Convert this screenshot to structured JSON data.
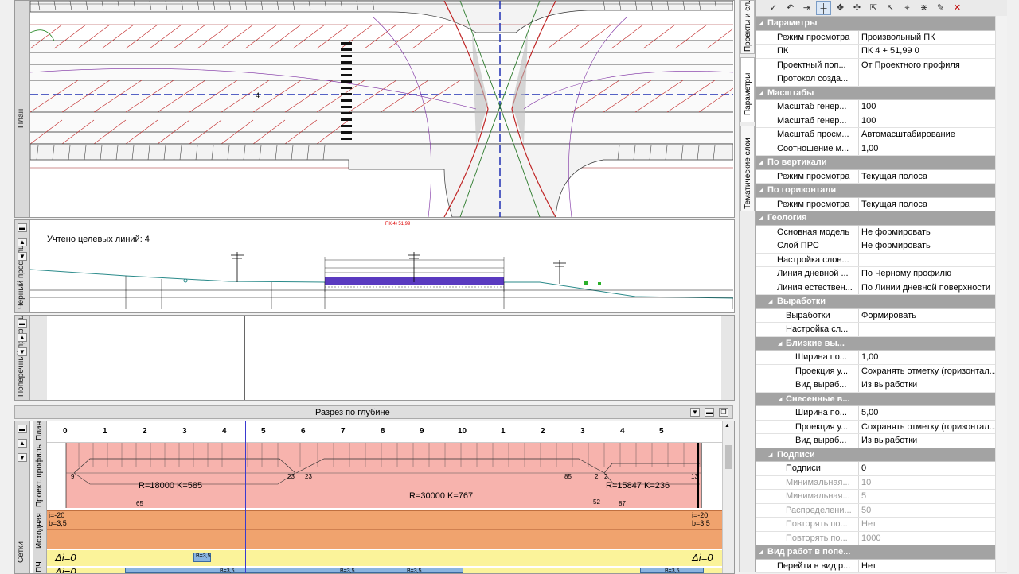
{
  "panes": {
    "plan": {
      "label": "План"
    },
    "profile": {
      "label": "Черный профиль",
      "target_lines": "Учтено целевых линий: 4",
      "pk_marker": "ПК 4+51,99",
      "axis_marker": "4"
    },
    "cross": {
      "label": "Поперечный профиль"
    },
    "depth": {
      "title": "Разрез по глубине"
    }
  },
  "grid": {
    "group_label": "Сетки",
    "row_labels": {
      "plan": "План",
      "design": "Проект. профиль",
      "source": "Исходная",
      "pch": "ПЧ"
    },
    "km_ticks": [
      "0",
      "1",
      "2",
      "3",
      "4",
      "5",
      "6",
      "7",
      "8",
      "9",
      "10",
      "1",
      "2",
      "3",
      "4",
      "5"
    ],
    "curves": [
      "R=18000  K=585",
      "R=30000  K=767",
      "R=15847  K=236"
    ],
    "curve_marks": [
      "9",
      "65",
      "23",
      "23",
      "85",
      "2",
      "2",
      "13",
      "52",
      "87"
    ],
    "slope_left_1": "i=-20",
    "slope_left_2": "b=3,5",
    "slope_right_1": "i=-20",
    "slope_right_2": "b=3,5",
    "delta_left": "Δi=0",
    "delta_right": "Δi=0",
    "pill_1": "B=3,5",
    "pill_2": "B=3,5",
    "pill_3": "B=3,5",
    "pill_4": "B=3,5",
    "pill_5": "B=3,5",
    "bottom_delta": "Δi=0"
  },
  "side_tabs": [
    "Проекты и сл...",
    "Параметры",
    "Тематические слои"
  ],
  "toolbar_icons": [
    "check-icon",
    "undo-icon",
    "next-icon",
    "crosshair-icon",
    "move-icon",
    "pan-icon",
    "select-icon",
    "pointer-icon",
    "snap-icon",
    "node-icon",
    "picker-icon",
    "close-icon"
  ],
  "properties": [
    {
      "t": "h",
      "k": "Параметры",
      "lv": 0
    },
    {
      "t": "r",
      "k": "Режим просмотра",
      "v": "Произвольный ПК",
      "lv": 0
    },
    {
      "t": "r",
      "k": "ПК",
      "v": "ПК    4 + 51,99  0",
      "lv": 0
    },
    {
      "t": "r",
      "k": "Проектный поп...",
      "v": "От Проектного профиля",
      "lv": 0
    },
    {
      "t": "r",
      "k": "Протокол созда...",
      "v": "",
      "lv": 0
    },
    {
      "t": "h",
      "k": "Масштабы",
      "lv": 0
    },
    {
      "t": "r",
      "k": "Масштаб генер...",
      "v": "100",
      "lv": 0
    },
    {
      "t": "r",
      "k": "Масштаб генер...",
      "v": "100",
      "lv": 0
    },
    {
      "t": "r",
      "k": "Масштаб просм...",
      "v": "Автомасштабирование",
      "lv": 0
    },
    {
      "t": "r",
      "k": "Соотношение м...",
      "v": "1,00",
      "lv": 0
    },
    {
      "t": "h",
      "k": "По вертикали",
      "lv": 0
    },
    {
      "t": "r",
      "k": "Режим просмотра",
      "v": "Текущая полоса",
      "lv": 0
    },
    {
      "t": "h",
      "k": "По горизонтали",
      "lv": 0
    },
    {
      "t": "r",
      "k": "Режим просмотра",
      "v": "Текущая полоса",
      "lv": 0
    },
    {
      "t": "h",
      "k": "Геология",
      "lv": 0
    },
    {
      "t": "r",
      "k": "Основная модель",
      "v": "Не формировать",
      "lv": 0
    },
    {
      "t": "r",
      "k": "Слой ПРС",
      "v": "Не формировать",
      "lv": 0
    },
    {
      "t": "r",
      "k": "Настройка слое...",
      "v": "",
      "lv": 0
    },
    {
      "t": "r",
      "k": "Линия дневной ...",
      "v": "По Черному профилю",
      "lv": 0
    },
    {
      "t": "r",
      "k": "Линия естествен...",
      "v": "По Линии дневной поверхности",
      "lv": 0
    },
    {
      "t": "h",
      "k": "Выработки",
      "lv": 1
    },
    {
      "t": "r",
      "k": "Выработки",
      "v": "Формировать",
      "lv": 1
    },
    {
      "t": "r",
      "k": "Настройка сл...",
      "v": "",
      "lv": 1
    },
    {
      "t": "h",
      "k": "Близкие вы...",
      "lv": 2
    },
    {
      "t": "r",
      "k": "Ширина по...",
      "v": "1,00",
      "lv": 2
    },
    {
      "t": "r",
      "k": "Проекция у...",
      "v": "Сохранять отметку (горизонтал...",
      "lv": 2
    },
    {
      "t": "r",
      "k": "Вид выраб...",
      "v": "Из выработки",
      "lv": 2
    },
    {
      "t": "h",
      "k": "Снесенные в...",
      "lv": 2
    },
    {
      "t": "r",
      "k": "Ширина по...",
      "v": "5,00",
      "lv": 2
    },
    {
      "t": "r",
      "k": "Проекция у...",
      "v": "Сохранять отметку (горизонтал...",
      "lv": 2
    },
    {
      "t": "r",
      "k": "Вид выраб...",
      "v": "Из выработки",
      "lv": 2
    },
    {
      "t": "h",
      "k": "Подписи",
      "lv": 1
    },
    {
      "t": "r",
      "k": "Подписи",
      "v": "0",
      "lv": 1
    },
    {
      "t": "r",
      "k": "Минимальная...",
      "v": "10",
      "lv": 1,
      "grey": true
    },
    {
      "t": "r",
      "k": "Минимальная...",
      "v": "5",
      "lv": 1,
      "grey": true
    },
    {
      "t": "r",
      "k": "Распределени...",
      "v": "50",
      "lv": 1,
      "grey": true
    },
    {
      "t": "r",
      "k": "Повторять по...",
      "v": "Нет",
      "lv": 1,
      "grey": true
    },
    {
      "t": "r",
      "k": "Повторять по...",
      "v": "1000",
      "lv": 1,
      "grey": true
    },
    {
      "t": "h",
      "k": "Вид работ в попе...",
      "lv": 0
    },
    {
      "t": "r",
      "k": "Перейти в вид р...",
      "v": "Нет",
      "lv": 0
    }
  ],
  "colors": {
    "design_band": "#f7b3ad",
    "source_band": "#f0a36e",
    "pch_band": "#fbf39a",
    "pill": "#8ab4e0",
    "header": "#a3a3a3"
  }
}
